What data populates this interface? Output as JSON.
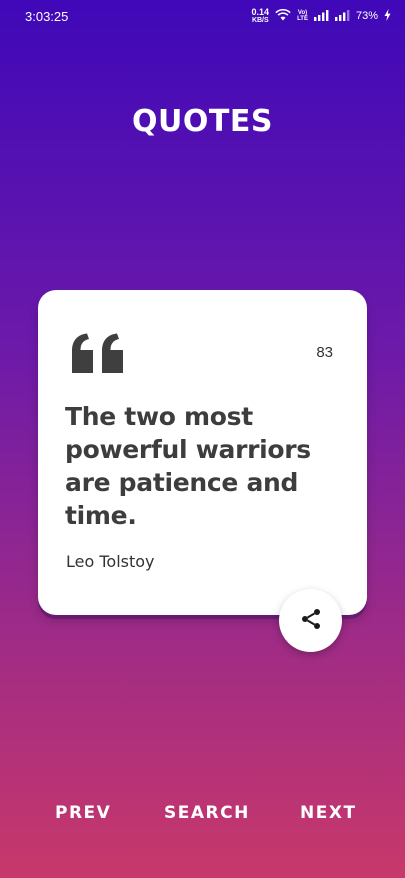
{
  "status_bar": {
    "time": "3:03:25",
    "net_speed_value": "0.14",
    "net_speed_unit": "KB/S",
    "volte_top": "Vo)",
    "volte_bottom": "LTE",
    "battery": "73%",
    "icons": [
      "wifi-icon",
      "signal-icon",
      "signal-icon",
      "battery-charging-icon"
    ]
  },
  "header": {
    "title": "QUOTES"
  },
  "quote": {
    "number": "83",
    "text": "The two most powerful warriors are patience and time.",
    "author": "Leo Tolstoy",
    "icon": "quote-mark-icon"
  },
  "share": {
    "icon": "share-icon"
  },
  "nav": {
    "prev_label": "PREV",
    "search_label": "SEARCH",
    "next_label": "NEXT"
  },
  "colors": {
    "gradient_top": "#3f08b8",
    "gradient_mid": "#6d1aa9",
    "gradient_bottom": "#c8386a",
    "card": "#ffffff",
    "text_dark": "#3d3d3d"
  }
}
